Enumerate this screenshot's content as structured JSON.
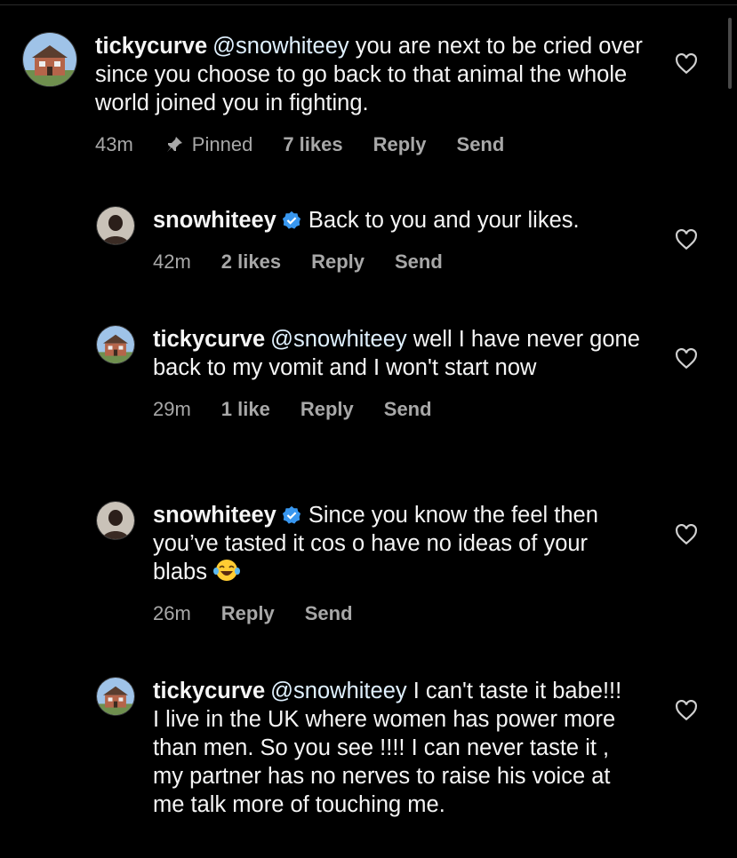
{
  "comments": [
    {
      "username": "tickycurve",
      "mention": "@snowhiteey",
      "text": " you are next to be cried over since you choose to go back to that animal the whole world joined you in fighting.",
      "time": "43m",
      "pinned": "Pinned",
      "likes": "7 likes",
      "reply": "Reply",
      "send": "Send",
      "avatar": "house-avatar"
    },
    {
      "username": "snowhiteey",
      "verified": true,
      "text": "Back to you and your likes.",
      "time": "42m",
      "likes": "2 likes",
      "reply": "Reply",
      "send": "Send",
      "avatar": "person-avatar"
    },
    {
      "username": "tickycurve",
      "mention": "@snowhiteey",
      "text": " well I have never gone back to my vomit and I won't start now",
      "time": "29m",
      "likes": "1 like",
      "reply": "Reply",
      "send": "Send",
      "avatar": "house-avatar"
    },
    {
      "username": "snowhiteey",
      "verified": true,
      "text": "Since you know the feel then you’ve tasted it cos o have no ideas of your blabs",
      "emoji": "laughing-tears-emoji",
      "time": "26m",
      "reply": "Reply",
      "send": "Send",
      "avatar": "person-avatar"
    },
    {
      "username": "tickycurve",
      "mention": "@snowhiteey",
      "text": " I can't taste it babe!!! I live in the UK where women has power more than men. So you see !!!! I can never taste it , my partner has no nerves to raise his voice at me talk more of touching me.",
      "avatar": "house-avatar"
    }
  ],
  "colors": {
    "background": "#000000",
    "text": "#f5f5f5",
    "meta": "#a8a8a8",
    "verified": "#3897f0"
  }
}
